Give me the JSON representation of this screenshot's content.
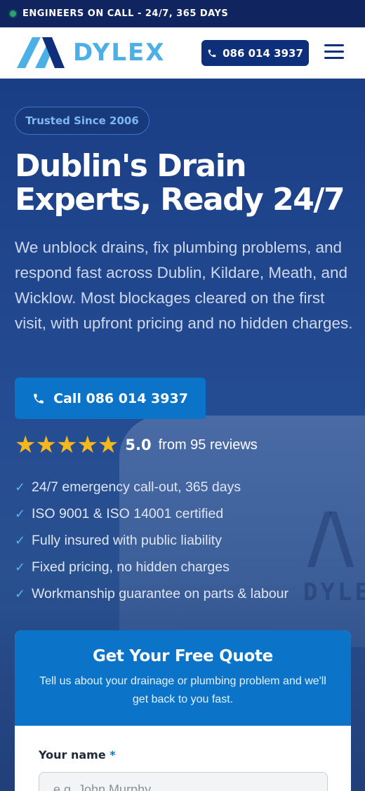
{
  "topbar": {
    "text": "ENGINEERS ON CALL - 24/7, 365 DAYS",
    "status_color": "#29a36a"
  },
  "header": {
    "logo_text": "DYLEX",
    "phone_button": "086 014 3937",
    "menu_icon": "hamburger-icon"
  },
  "hero": {
    "badge": "Trusted Since 2006",
    "title_line1": "Dublin's Drain",
    "title_line2": "Experts, Ready 24/7",
    "lead": "We unblock drains, fix plumbing problems, and respond fast across Dublin, Kildare, Meath, and Wicklow. Most blockages cleared on the first visit, with upfront pricing and no hidden charges.",
    "cta_label": "Call 086 014 3937",
    "rating_stars": "★★★★★",
    "rating_value": "5.0",
    "rating_reviews": "from 95 reviews",
    "features": [
      "24/7 emergency call-out, 365 days",
      "ISO 9001 & ISO 14001 certified",
      "Fully insured with public liability",
      "Fixed pricing, no hidden charges",
      "Workmanship guarantee on parts & labour"
    ],
    "van_text": "DYLE"
  },
  "quote": {
    "title": "Get Your Free Quote",
    "subtitle": "Tell us about your drainage or plumbing problem and we'll get back to you fast.",
    "name_label": "Your name",
    "required_mark": "*",
    "name_placeholder": "e.g. John Murphy",
    "name_value": ""
  },
  "colors": {
    "brand_dark": "#0e2f7a",
    "brand_light": "#4cb0e6",
    "accent": "#0b74c8",
    "star": "#f5b71c"
  }
}
